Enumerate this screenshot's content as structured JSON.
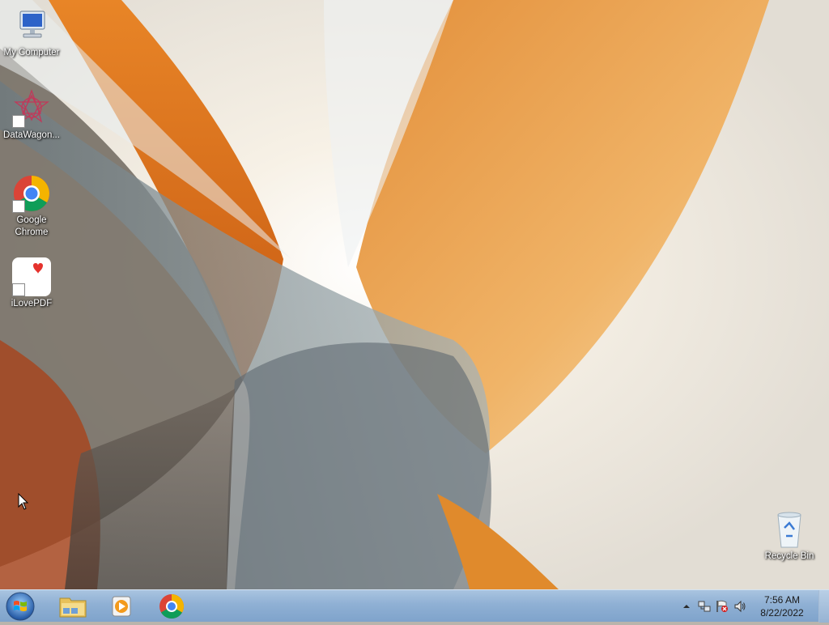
{
  "desktop": {
    "icons": [
      {
        "label": "My Computer",
        "icon": "computer-icon"
      },
      {
        "label": "DataWagon...",
        "icon": "datawagon-icon"
      },
      {
        "label": "Google Chrome",
        "icon": "chrome-icon"
      },
      {
        "label": "iLovePDF",
        "icon": "ilovepdf-icon"
      },
      {
        "label": "Recycle Bin",
        "icon": "recycle-bin-icon"
      }
    ]
  },
  "taskbar": {
    "pinned": [
      {
        "icon": "windows-explorer-icon"
      },
      {
        "icon": "media-player-icon"
      },
      {
        "icon": "chrome-icon"
      }
    ],
    "tray": {
      "icons": [
        "show-hidden-icons-arrow",
        "network-icon",
        "action-center-flag-icon",
        "volume-icon"
      ],
      "time": "7:56 AM",
      "date": "8/22/2022"
    }
  },
  "colors": {
    "taskbar": "#8fb0d4",
    "wallpaper_orange": "#e07a1f",
    "wallpaper_cream": "#f5efe2"
  }
}
